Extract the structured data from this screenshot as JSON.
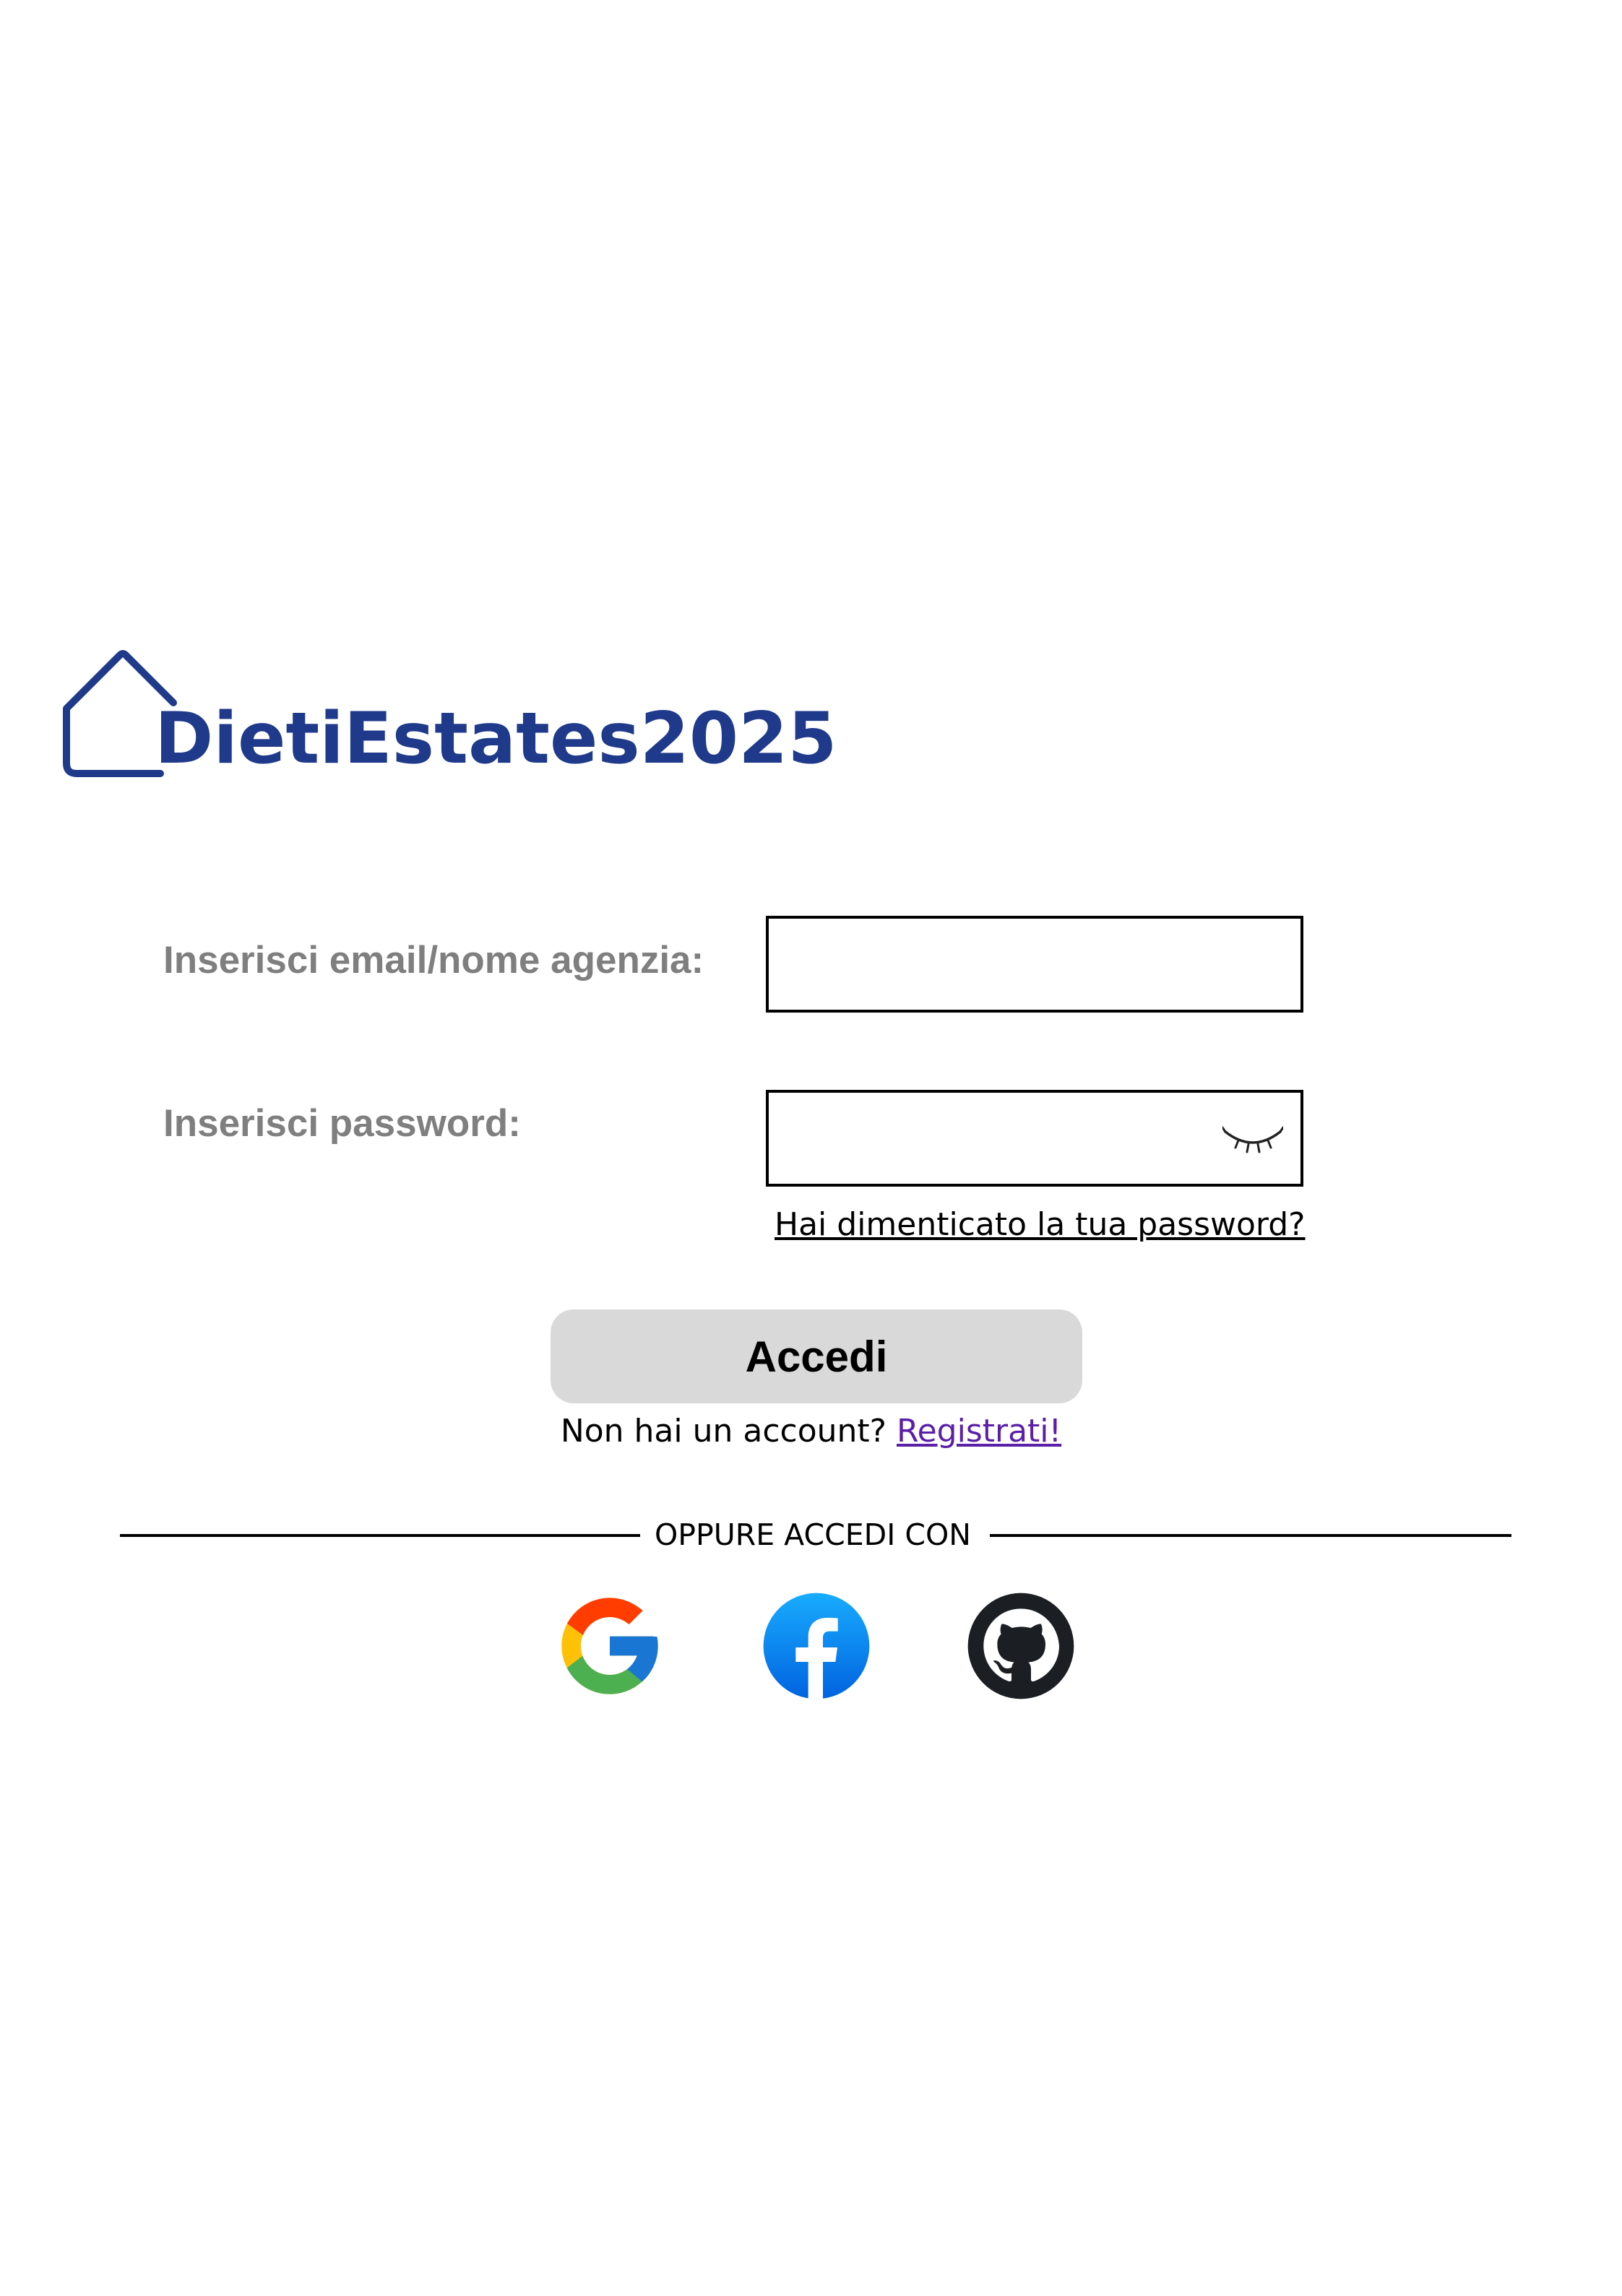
{
  "brand": {
    "name": "DietiEstates2025",
    "color": "#1f3a8a"
  },
  "form": {
    "email_label": "Inserisci email/nome agenzia:",
    "email_value": "",
    "password_label": "Inserisci password:",
    "password_value": "",
    "password_toggle_icon": "eye-closed-icon",
    "forgot_password": "Hai dimenticato la tua password?",
    "submit_label": "Accedi",
    "label_color": "#7f7f7f",
    "button_color": "#d9d9d9"
  },
  "signup": {
    "prompt": "Non hai un account?",
    "link": "Registrati!",
    "link_color": "#5b1fa8"
  },
  "social": {
    "divider_text": "OPPURE ACCEDI CON",
    "providers": [
      {
        "name": "Google",
        "icon": "google-icon"
      },
      {
        "name": "Facebook",
        "icon": "facebook-icon"
      },
      {
        "name": "GitHub",
        "icon": "github-icon"
      }
    ]
  }
}
